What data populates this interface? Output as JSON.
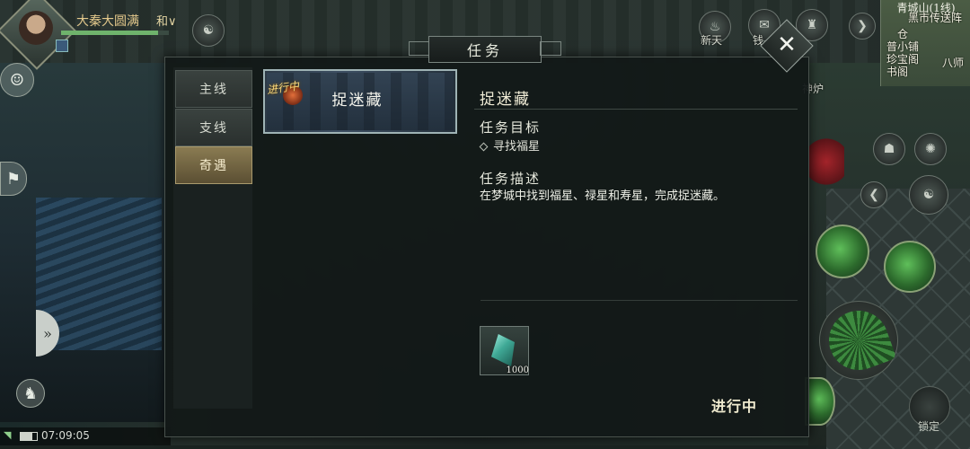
{
  "player": {
    "name": "大秦大圆满",
    "server": "和∨",
    "hp_fraction": 0.9
  },
  "top_hud": {
    "left_icon_label": "新天",
    "middle_icon_label": "钱",
    "right_icon_label": "神炉"
  },
  "minimap": {
    "location": "青城山(1线)",
    "markers": [
      "黑市传送阵",
      "仓",
      "普小铺",
      "珍宝阁",
      "书阁",
      "八师"
    ]
  },
  "panel": {
    "title": "任务",
    "close_icon": "close-icon"
  },
  "tabs": [
    {
      "label": "主线",
      "active": false
    },
    {
      "label": "支线",
      "active": false
    },
    {
      "label": "奇遇",
      "active": true
    }
  ],
  "quest": {
    "badge": "进行中",
    "name": "捉迷藏"
  },
  "detail": {
    "title": "捉迷藏",
    "goal_header": "任务目标",
    "goal_item": "寻找福星",
    "desc_header": "任务描述",
    "desc_text": "在梦城中找到福星、禄星和寿星，完成捉迷藏。"
  },
  "reward": {
    "item_icon": "crystal-icon",
    "count": "1000"
  },
  "status_button": "进行中",
  "right_hud": {
    "lock_label": "锁定"
  },
  "system": {
    "time": "07:09:05"
  },
  "colors": {
    "gold_text": "#f7d77a",
    "active_tab": "#8a7b52",
    "panel_bg": "#121817"
  }
}
